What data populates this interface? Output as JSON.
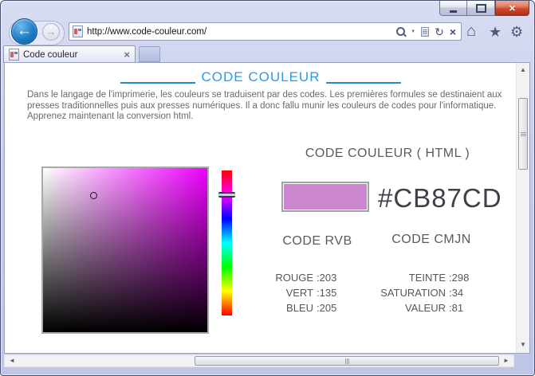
{
  "browser": {
    "url": "http://www.code-couleur.com/",
    "tab": {
      "title": "Code couleur"
    }
  },
  "icons": {
    "back": "←",
    "forward": "→",
    "search_caret": "▼",
    "refresh": "↻",
    "stop": "×",
    "home": "⌂",
    "favorites": "★",
    "tools": "⚙",
    "tab_close": "×",
    "window_close": "×",
    "scroll_up": "▲",
    "scroll_down": "▼",
    "scroll_left": "◄",
    "scroll_right": "►"
  },
  "page": {
    "title": "CODE COULEUR",
    "intro_lines": [
      "Dans le langage de l'imprimerie, les couleurs se traduisent par des codes. Les premières formules se destinaient aux",
      "presses traditionnelles puis aux presses numériques. Il a donc fallu munir les couleurs de codes pour l'informatique.",
      "Apprenez maintenant la conversion html."
    ],
    "html_section": {
      "heading": "CODE COULEUR ( HTML )",
      "hex_code": "#CB87CD"
    },
    "rvb_section": {
      "heading": "CODE RVB",
      "rows": [
        {
          "label": "ROUGE",
          "value": "203"
        },
        {
          "label": "VERT",
          "value": "135"
        },
        {
          "label": "BLEU",
          "value": "205"
        }
      ]
    },
    "cmjn_section": {
      "heading": "CODE CMJN",
      "rows": [
        {
          "label": "TEINTE",
          "value": "298"
        },
        {
          "label": "SATURATION",
          "value": "34"
        },
        {
          "label": "VALEUR",
          "value": "81"
        }
      ]
    },
    "colors": {
      "swatch": "#CB87CD",
      "picker_hue": "#EF00FF",
      "title_blue": "#2B9BE8"
    }
  }
}
